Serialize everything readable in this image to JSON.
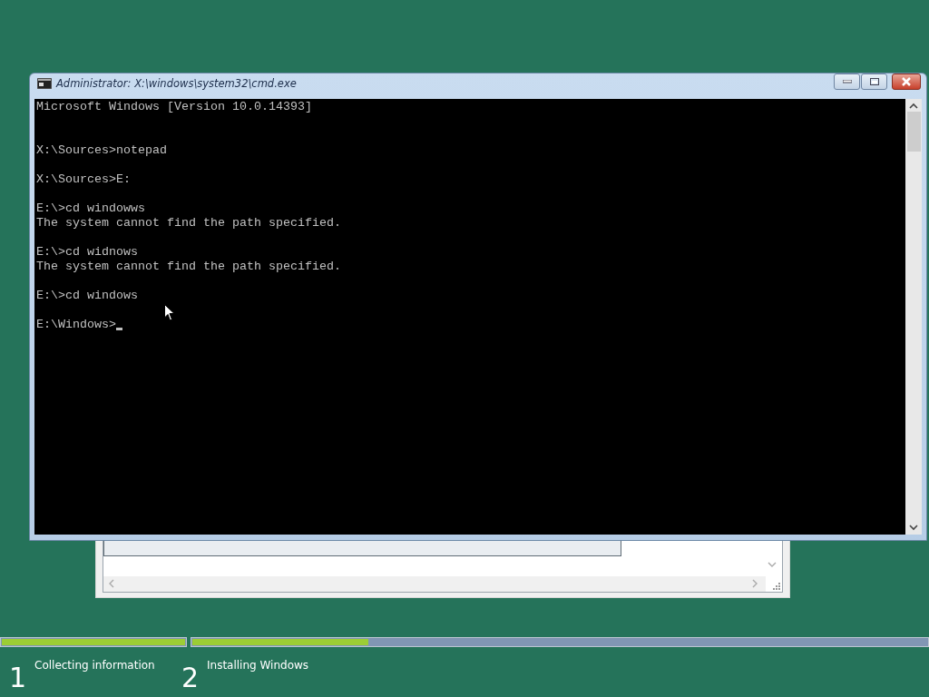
{
  "console_window": {
    "title": "Administrator: X:\\windows\\system32\\cmd.exe",
    "header": "Microsoft Windows [Version 10.0.14393]",
    "blocks": [
      [
        "X:\\Sources>notepad"
      ],
      [
        "X:\\Sources>E:"
      ],
      [
        "E:\\>cd windowws",
        "The system cannot find the path specified."
      ],
      [
        "E:\\>cd widnows",
        "The system cannot find the path specified."
      ],
      [
        "E:\\>cd windows"
      ],
      [
        "E:\\Windows>"
      ]
    ]
  },
  "progress": [
    {
      "level": 1
    },
    {
      "level": 0.24
    }
  ],
  "steps": [
    {
      "number": "1",
      "label": "Collecting information"
    },
    {
      "number": "2",
      "label": "Installing Windows"
    }
  ]
}
